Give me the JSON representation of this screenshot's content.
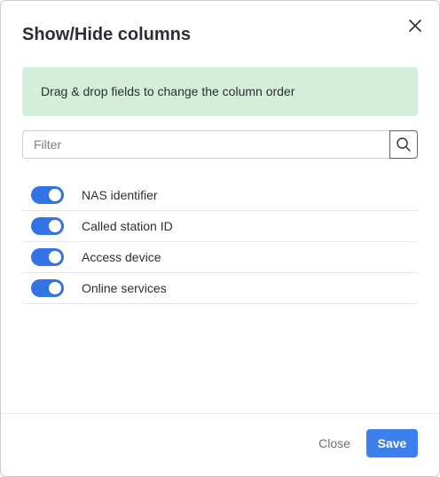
{
  "dialog": {
    "title": "Show/Hide columns",
    "close_icon": "close-icon"
  },
  "info": {
    "text": "Drag & drop fields to change the column order"
  },
  "filter": {
    "placeholder": "Filter",
    "value": "",
    "search_icon": "search-icon"
  },
  "columns": [
    {
      "label": "NAS identifier",
      "enabled": true
    },
    {
      "label": "Called station ID",
      "enabled": true
    },
    {
      "label": "Access device",
      "enabled": true
    },
    {
      "label": "Online services",
      "enabled": true
    }
  ],
  "footer": {
    "close_label": "Close",
    "save_label": "Save"
  },
  "colors": {
    "accent": "#3c7fed",
    "toggle_on": "#3273e6",
    "info_bg": "#d3eedb"
  }
}
